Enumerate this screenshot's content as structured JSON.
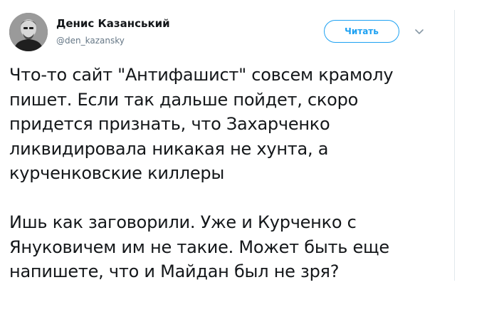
{
  "author": {
    "display_name": "Денис Казанський",
    "handle": "@den_kazansky",
    "avatar_icon": "user-avatar-photo"
  },
  "actions": {
    "follow_label": "Читать",
    "more_icon": "chevron-down-icon"
  },
  "tweet": {
    "lines": [
      "Что-то сайт \"Антифашист\" совсем крамолу",
      "пишет. Если так дальше пойдет, скоро",
      "придется признать, что Захарченко",
      "ликвидировала никакая не хунта, а",
      "курченковские киллеры",
      "",
      "Ишь как заговорили. Уже и Курченко с",
      "Януковичем им не такие. Может быть еще",
      "напишете, что и Майдан был не зря?"
    ]
  },
  "colors": {
    "accent": "#1da1f2",
    "text": "#14171a",
    "secondary_text": "#657786",
    "divider": "#e1e8ed"
  }
}
